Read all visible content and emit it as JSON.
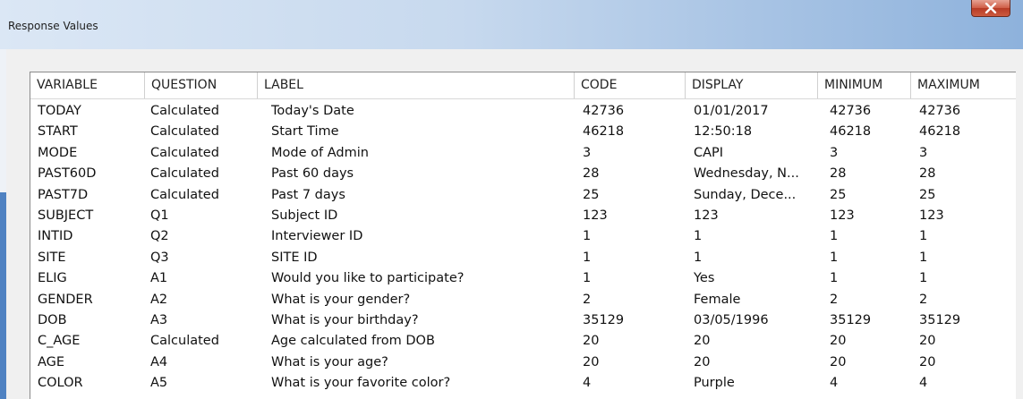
{
  "window": {
    "title": "Response Values",
    "close_icon": "close-x-icon"
  },
  "columns": [
    "VARIABLE",
    "QUESTION",
    "LABEL",
    "CODE",
    "DISPLAY",
    "MINIMUM",
    "MAXIMUM"
  ],
  "rows": [
    [
      "TODAY",
      "Calculated",
      "Today's Date",
      "42736",
      "01/01/2017",
      "42736",
      "42736"
    ],
    [
      "START",
      "Calculated",
      "Start Time",
      "46218",
      "12:50:18",
      "46218",
      "46218"
    ],
    [
      "MODE",
      "Calculated",
      "Mode of Admin",
      "3",
      "CAPI",
      "3",
      "3"
    ],
    [
      "PAST60D",
      "Calculated",
      "Past 60 days",
      "28",
      "Wednesday, N...",
      "28",
      "28"
    ],
    [
      "PAST7D",
      "Calculated",
      "Past 7 days",
      "25",
      "Sunday, Dece...",
      "25",
      "25"
    ],
    [
      "SUBJECT",
      "Q1",
      "Subject ID",
      "123",
      "123",
      "123",
      "123"
    ],
    [
      "INTID",
      "Q2",
      "Interviewer ID",
      "1",
      "1",
      "1",
      "1"
    ],
    [
      "SITE",
      "Q3",
      "SITE ID",
      "1",
      "1",
      "1",
      "1"
    ],
    [
      "ELIG",
      "A1",
      "Would you like to participate?",
      "1",
      "Yes",
      "1",
      "1"
    ],
    [
      "GENDER",
      "A2",
      "What is your gender?",
      "2",
      "Female",
      "2",
      "2"
    ],
    [
      "DOB",
      "A3",
      "What is your birthday?",
      "35129",
      "03/05/1996",
      "35129",
      "35129"
    ],
    [
      "C_AGE",
      "Calculated",
      "Age calculated from DOB",
      "20",
      "20",
      "20",
      "20"
    ],
    [
      "AGE",
      "A4",
      "What is your age?",
      "20",
      "20",
      "20",
      "20"
    ],
    [
      "COLOR",
      "A5",
      "What is your favorite color?",
      "4",
      "Purple",
      "4",
      "4"
    ]
  ]
}
